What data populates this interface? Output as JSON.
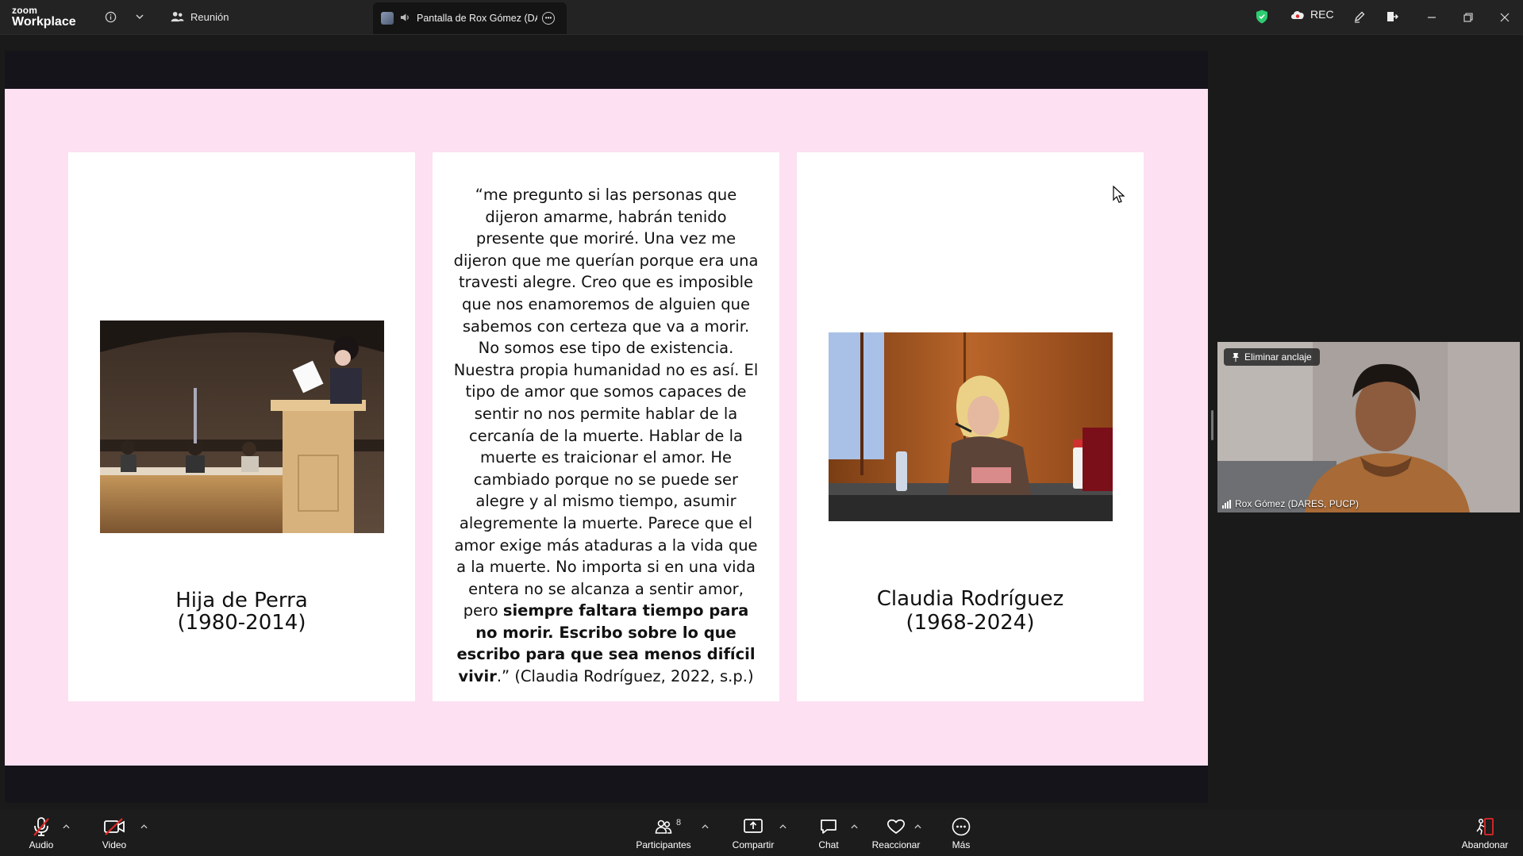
{
  "app": {
    "logo_top": "zoom",
    "logo_bottom": "Workplace"
  },
  "titlebar": {
    "meeting_tab_label": "Reunión",
    "share_tab_label": "Pantalla de Rox Gómez (DAR",
    "rec_label": "REC",
    "icons": [
      "info-icon",
      "chevron-down-icon",
      "people-icon",
      "shield-icon",
      "cloud-icon",
      "pen-icon",
      "exit-share-icon",
      "minimize-icon",
      "restore-icon",
      "close-icon"
    ]
  },
  "slide": {
    "left_card": {
      "name": "Hija de Perra",
      "years": "(1980-2014)"
    },
    "quote": {
      "text_regular": "“me pregunto si las personas que dijeron amarme, habrán tenido presente que moriré. Una vez me dijeron que me querían porque era una travesti alegre. Creo que es imposible que nos enamoremos de alguien que sabemos con certeza que va a morir. No somos ese tipo de existencia. Nuestra propia humanidad no es así. El tipo de amor que somos capaces de sentir no nos permite hablar de la cercanía de la muerte. Hablar de la muerte es traicionar el amor. He cambiado porque no se puede ser alegre y al mismo tiempo, asumir alegremente la muerte. Parece que el amor exige más ataduras a la vida que a la muerte. No importa si en una vida entera no se alcanza a sentir amor, pero ",
      "text_bold": "siempre faltara tiempo para no morir. Escribo sobre lo que escribo para que sea menos difícil vivir",
      "text_end": ".” (Claudia Rodríguez, 2022, s.p.)"
    },
    "right_card": {
      "name": "Claudia Rodríguez",
      "years": "(1968-2024)"
    }
  },
  "participant": {
    "unpin_label": "Eliminar anclaje",
    "name": "Rox Gómez (DARES, PUCP)"
  },
  "toolbar": {
    "audio_label": "Audio",
    "video_label": "Video",
    "participants_label": "Participantes",
    "participants_count": "8",
    "share_label": "Compartir",
    "chat_label": "Chat",
    "react_label": "Reaccionar",
    "more_label": "Más",
    "leave_label": "Abandonar"
  },
  "colors": {
    "slide_bg": "#fde0f2",
    "leave_red": "#e02828",
    "shield_green": "#2ecc71"
  }
}
